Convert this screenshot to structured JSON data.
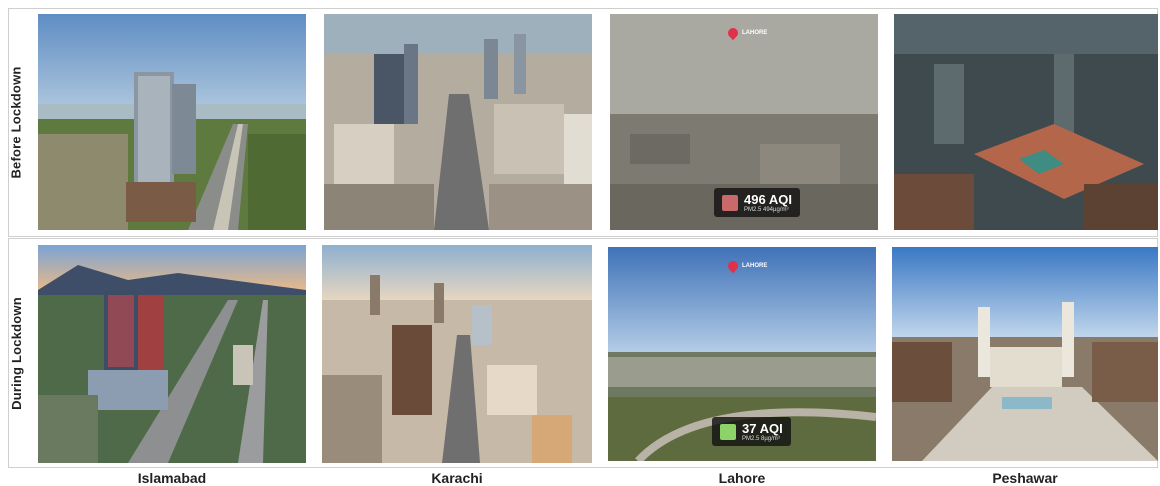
{
  "rows": {
    "before": "Before Lockdown",
    "during": "During Lockdown"
  },
  "cities": [
    "Islamabad",
    "Karachi",
    "Lahore",
    "Peshawar"
  ],
  "lahore_before_overlay": {
    "aqi": "496 AQI",
    "pollutant": "PM2.5 494µg/m³"
  },
  "lahore_during_overlay": {
    "aqi": "37 AQI",
    "pollutant": "PM2.5 8µg/m³"
  },
  "lahore_pin_label": "LAHORE",
  "colors": {
    "aqi_hazardous": "#c96a6a",
    "aqi_good": "#8ed26a",
    "pin": "#e0304a"
  }
}
